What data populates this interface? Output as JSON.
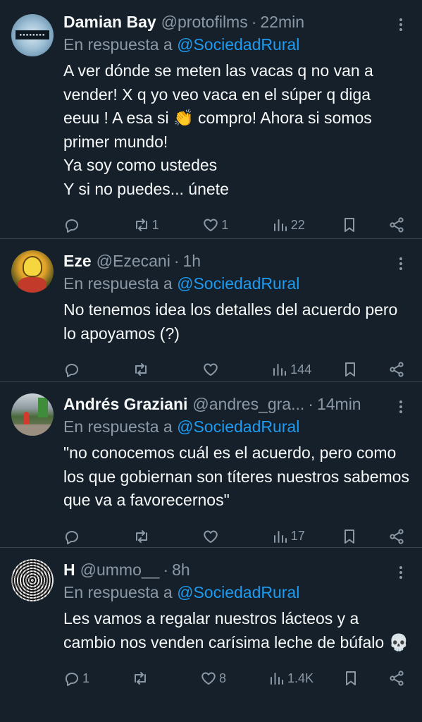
{
  "reply_prefix": "En respuesta a",
  "dot": "·",
  "tweets": [
    {
      "name": "Damian Bay",
      "handle": "@protofilms",
      "time": "22min",
      "reply_to": "@SociedadRural",
      "text": "A ver dónde se meten las vacas q no van a vender! X q yo veo vaca en el súper q diga eeuu ! A esa si 👏 compro! Ahora si somos primer mundo!\nYa soy como ustedes\nY si no puedes... únete",
      "replies": "",
      "retweets": "1",
      "likes": "1",
      "views": "22",
      "avatar_icon": "protofilms-logo-avatar"
    },
    {
      "name": "Eze",
      "handle": "@Ezecani",
      "time": "1h",
      "reply_to": "@SociedadRural",
      "text": "No tenemos idea los detalles del acuerdo pero lo apoyamos (?)",
      "replies": "",
      "retweets": "",
      "likes": "",
      "views": "144",
      "avatar_icon": "cartoon-character-avatar"
    },
    {
      "name": "Andrés Graziani",
      "handle": "@andres_gra...",
      "time": "14min",
      "reply_to": "@SociedadRural",
      "text": "\"no conocemos cuál es el acuerdo, pero como los que gobiernan son títeres nuestros sabemos que va a favorecernos\"",
      "replies": "",
      "retweets": "",
      "likes": "",
      "views": "17",
      "avatar_icon": "street-photo-avatar"
    },
    {
      "name": "H",
      "handle": "@ummo__",
      "time": "8h",
      "reply_to": "@SociedadRural",
      "text": "Les vamos a regalar nuestros lácteos y a cambio nos venden carísima leche de búfalo 💀",
      "replies": "1",
      "retweets": "",
      "likes": "8",
      "views": "1.4K",
      "avatar_icon": "op-art-pattern-avatar"
    }
  ]
}
